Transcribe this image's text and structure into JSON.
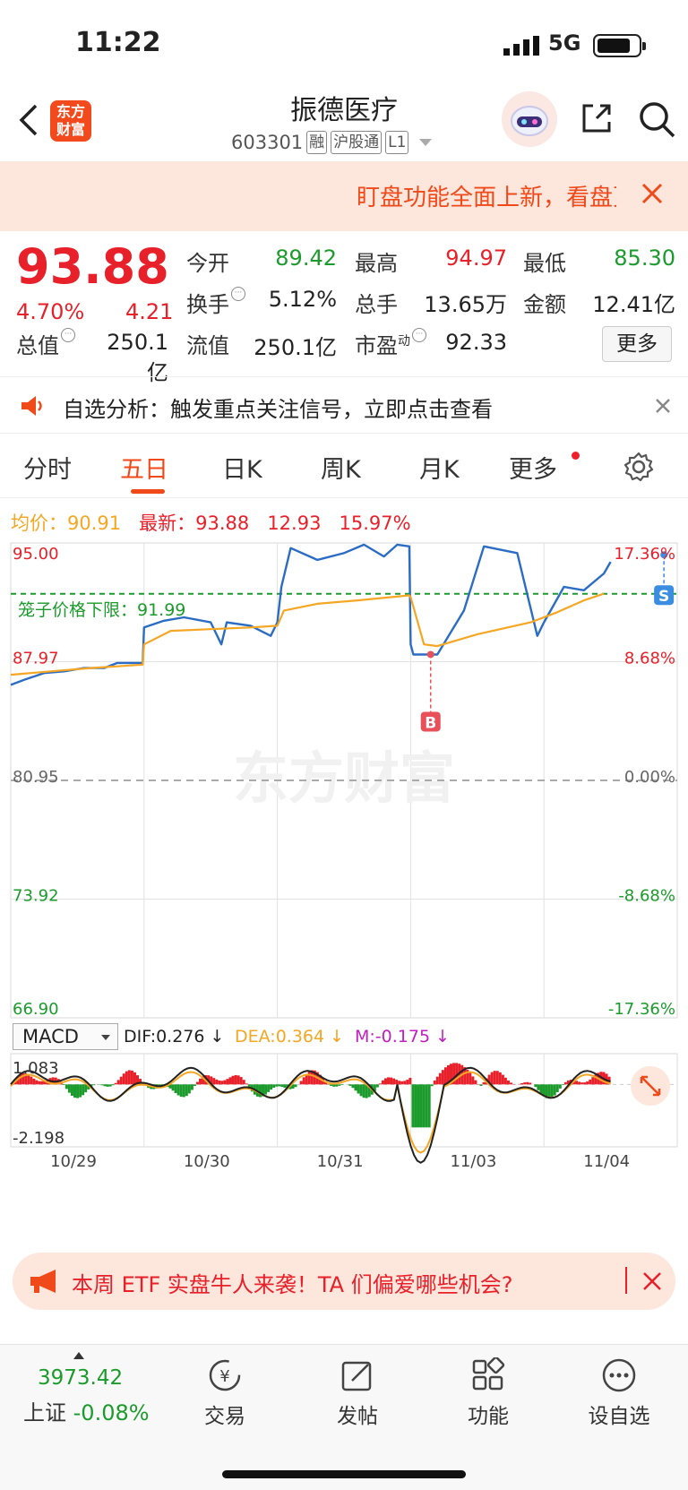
{
  "status": {
    "time": "11:22",
    "network": "5G"
  },
  "header": {
    "logo_text_1": "东方",
    "logo_text_2": "财富",
    "stock_name": "振德医疗",
    "stock_code": "603301",
    "tags": [
      "融",
      "沪股通",
      "L1"
    ]
  },
  "banner_top": {
    "text": "盯盘功能全面上新，看盘更"
  },
  "quote": {
    "price": "93.88",
    "change_pct": "4.70%",
    "change_val": "4.21",
    "labels": {
      "open": "今开",
      "high": "最高",
      "low": "最低",
      "turnover": "换手",
      "volume": "总手",
      "amount": "金额",
      "total_value": "总值",
      "float_value": "流值",
      "pe": "市盈",
      "pe_sup": "动"
    },
    "values": {
      "open": "89.42",
      "high": "94.97",
      "low": "85.30",
      "turnover": "5.12%",
      "volume": "13.65万",
      "amount": "12.41亿",
      "total_value": "250.1亿",
      "float_value": "250.1亿",
      "pe": "92.33"
    },
    "more_label": "更多"
  },
  "alert": {
    "text": "自选分析：触发重点关注信号，立即点击查看"
  },
  "tabs": [
    "分时",
    "五日",
    "日K",
    "周K",
    "月K",
    "更多"
  ],
  "legend": {
    "avg_label": "均价：",
    "avg_value": "90.91",
    "latest_label": "最新：",
    "latest_value": "93.88",
    "latest_change": "12.93",
    "latest_pct": "15.97%"
  },
  "chart_data": {
    "type": "line",
    "days": [
      "10/29",
      "10/30",
      "10/31",
      "11/03",
      "11/04"
    ],
    "y_ticks_left": [
      "95.00",
      "87.97",
      "80.95",
      "73.92",
      "66.90"
    ],
    "y_ticks_right": [
      "17.36%",
      "8.68%",
      "0.00%",
      "-8.68%",
      "-17.36%"
    ],
    "ylim": [
      66.9,
      95.0
    ],
    "prev_close": 80.95,
    "cage_label": "笼子价格下限：",
    "cage_value": "91.99",
    "cage_price": 91.99,
    "markers": [
      {
        "label": "B",
        "day": 3,
        "frac": 0.15,
        "price": 88.4
      },
      {
        "label": "S",
        "day": 4,
        "frac": 0.9,
        "price": 94.3
      }
    ],
    "series": [
      {
        "color": "#2b6cc4",
        "points": [
          [
            0,
            86.6
          ],
          [
            0.1,
            86.9
          ],
          [
            0.25,
            87.3
          ],
          [
            0.4,
            87.4
          ],
          [
            0.55,
            87.6
          ],
          [
            0.7,
            87.6
          ],
          [
            0.8,
            87.9
          ],
          [
            0.99,
            87.9
          ],
          [
            1.0,
            90.0
          ],
          [
            1.15,
            90.4
          ],
          [
            1.3,
            90.6
          ],
          [
            1.5,
            90.3
          ],
          [
            1.58,
            89.0
          ],
          [
            1.62,
            90.3
          ],
          [
            1.8,
            90.1
          ],
          [
            1.95,
            89.5
          ],
          [
            2.0,
            90.3
          ],
          [
            2.03,
            92.4
          ],
          [
            2.1,
            94.7
          ],
          [
            2.3,
            94.0
          ],
          [
            2.5,
            94.4
          ],
          [
            2.65,
            94.9
          ],
          [
            2.8,
            94.2
          ],
          [
            2.9,
            94.9
          ],
          [
            2.99,
            94.8
          ],
          [
            3.0,
            89.0
          ],
          [
            3.02,
            88.4
          ],
          [
            3.2,
            88.4
          ],
          [
            3.4,
            91.0
          ],
          [
            3.55,
            94.8
          ],
          [
            3.8,
            94.4
          ],
          [
            3.95,
            89.5
          ],
          [
            4.0,
            90.3
          ],
          [
            4.15,
            92.4
          ],
          [
            4.3,
            92.2
          ],
          [
            4.45,
            93.2
          ],
          [
            4.5,
            93.88
          ]
        ]
      },
      {
        "color": "#f5a623",
        "points": [
          [
            0,
            87.2
          ],
          [
            0.3,
            87.4
          ],
          [
            0.6,
            87.6
          ],
          [
            0.99,
            87.8
          ],
          [
            1.0,
            89.0
          ],
          [
            1.2,
            89.8
          ],
          [
            1.5,
            89.9
          ],
          [
            1.8,
            90.0
          ],
          [
            2.0,
            90.1
          ],
          [
            2.05,
            91.0
          ],
          [
            2.3,
            91.4
          ],
          [
            2.6,
            91.6
          ],
          [
            2.99,
            91.9
          ],
          [
            3.0,
            91.8
          ],
          [
            3.1,
            89.0
          ],
          [
            3.2,
            88.9
          ],
          [
            3.5,
            89.6
          ],
          [
            3.9,
            90.3
          ],
          [
            4.1,
            90.9
          ],
          [
            4.3,
            91.6
          ],
          [
            4.45,
            92.0
          ]
        ]
      }
    ]
  },
  "macd": {
    "select_label": "MACD",
    "dif": "DIF:0.276",
    "dea": "DEA:0.364",
    "m": "M:-0.175",
    "top": "1.083",
    "bottom": "-2.198"
  },
  "banner_bottom": {
    "text": "本周 ETF 实盘牛人来袭！TA 们偏爱哪些机会?"
  },
  "bottom_nav": {
    "index_value": "3973.42",
    "index_name": "上证",
    "index_pct": "-0.08%",
    "items": [
      "交易",
      "发帖",
      "功能",
      "设自选"
    ]
  },
  "colors": {
    "up": "#e8202a",
    "down": "#1b9b2b",
    "accent": "#f04a1a",
    "price_line": "#2b6cc4",
    "avg_line": "#f5a623"
  }
}
